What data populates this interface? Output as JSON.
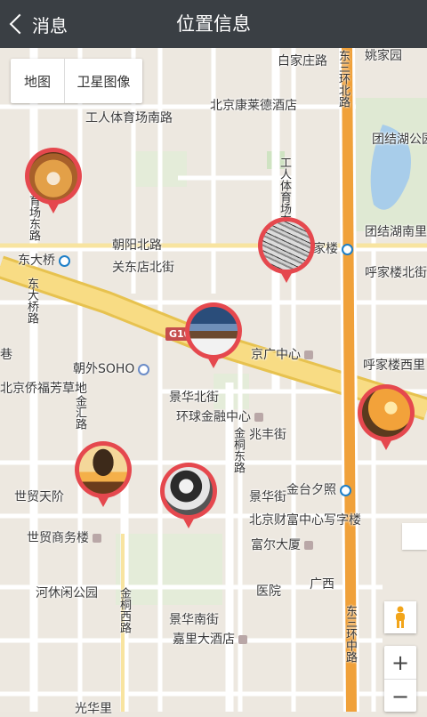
{
  "header": {
    "back_label": "消息",
    "title": "位置信息"
  },
  "map_toggle": {
    "map": "地图",
    "satellite": "卫星图像"
  },
  "labels": {
    "baijiazhuang": "白家庄路",
    "yaojiayuan": "姚家园",
    "gongti_south": "工人体育场南路",
    "kempinski": "北京康莱德酒店",
    "tuanjiehu_park": "团结湖公园",
    "east3ring_north": "东三环北路",
    "east3ring_mid": "东三环中路",
    "tuanjiehu_south": "团结湖南里",
    "chaoyang_north": "朝阳北路",
    "jiaban": "家楼",
    "dongdaqiao_station": "东大桥",
    "guandong": "关东店北街",
    "hujialou_north": "呼家楼北街",
    "dongdaqiao_road": "东大桥路",
    "gongti_east": "工人体育场东路",
    "gongti_east2": "东",
    "xiang": "巷",
    "g10": "G10",
    "jingguang": "京广中心",
    "hujialou_west": "呼家楼西里",
    "chaowai_soho": "朝外SOHO",
    "qiaofu": "北京侨福芳草地",
    "jinghua_north": "景华北街",
    "world_financial": "环球金融中心",
    "jinhui": "金汇路",
    "zhaofeng": "兆丰街",
    "jintong_east": "金桐东路",
    "jintai": "金台夕照",
    "jinghua_st": "景华街",
    "world_tianjie": "世贸天阶",
    "world_trade_tower": "世贸商务楼",
    "fortune_center": "北京财富中心写字楼",
    "fuer": "富尔大厦",
    "guanghua": "广西",
    "leisure_park": "河休闲公园",
    "hospital": "医院",
    "jintong_west": "金桐西路",
    "jinghua_south": "景华南街",
    "kerry": "嘉里大酒店",
    "guanghua_li": "光华里",
    "east3ring_south": "东三环中路",
    "east3ring_road": "东三",
    "guang": "光"
  },
  "markers": [
    {
      "name": "marker-dog",
      "colors": [
        "#e0a24c",
        "#7a4b22"
      ]
    },
    {
      "name": "marker-sketch",
      "colors": [
        "#cfcfcf",
        "#555555"
      ]
    },
    {
      "name": "marker-cabin",
      "colors": [
        "#2a4d7a",
        "#f2f2f2"
      ]
    },
    {
      "name": "marker-sunset",
      "colors": [
        "#f2a23a",
        "#5b3a1e"
      ]
    },
    {
      "name": "marker-tree",
      "colors": [
        "#f4b04a",
        "#3d2a1a"
      ]
    },
    {
      "name": "marker-woman",
      "colors": [
        "#e6e6e6",
        "#2b2b2b"
      ]
    }
  ],
  "controls": {
    "zoom_in": "+",
    "zoom_out": "−"
  },
  "colors": {
    "header_bg": "#3a3f44",
    "marker": "#e5484e",
    "ring_road": "#f0a13a",
    "highway": "#f3d77a"
  }
}
